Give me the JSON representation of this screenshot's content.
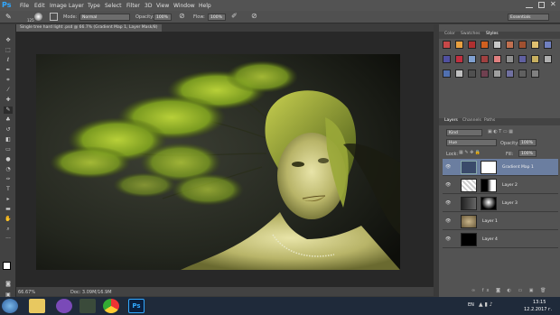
{
  "app": {
    "logo": "Ps"
  },
  "menu": [
    "File",
    "Edit",
    "Image",
    "Layer",
    "Type",
    "Select",
    "Filter",
    "3D",
    "View",
    "Window",
    "Help"
  ],
  "options": {
    "mode_label": "Mode:",
    "mode_value": "Normal",
    "opacity_label": "Opacity:",
    "opacity_value": "100%",
    "flow_label": "Flow:",
    "flow_value": "100%",
    "brush_size": "125",
    "workspace": "Essentials"
  },
  "document": {
    "tab_title": "Single tree  hard light .psd @ 66.7% (Gradient Map 1, Layer Mask/8)",
    "zoom": "66.67%",
    "doc_info": "Doc: 3.09M/16.9M"
  },
  "panels": {
    "color_tabs": [
      "Color",
      "Swatches",
      "Styles"
    ],
    "layer_tabs": [
      "Layers",
      "Channels",
      "Paths"
    ],
    "kind_label": "Kind",
    "blend_mode": "Hue",
    "opacity_label": "Opacity:",
    "opacity_value": "100%",
    "lock_label": "Lock:",
    "fill_label": "Fill:",
    "fill_value": "100%",
    "style_colors": [
      "#c84848",
      "#e8a040",
      "#b03030",
      "#d06020",
      "#c8c8c8",
      "#c07050",
      "#a05030",
      "#e0c070",
      "#7080c0",
      "#5050a0",
      "#c03040",
      "#80a0d0",
      "#a04040",
      "#e08080",
      "#909090",
      "#6060a0",
      "#c8b060",
      "#b0b0b0",
      "#5070b0",
      "#c0c0c0",
      "#505050",
      "#704050",
      "#a0a0a0",
      "#7070a0",
      "#606060",
      "#808080"
    ]
  },
  "layers": [
    {
      "name": "Gradient Map 1",
      "selected": true
    },
    {
      "name": "Layer 2",
      "selected": false
    },
    {
      "name": "Layer 3",
      "selected": false
    },
    {
      "name": "Layer 1",
      "selected": false
    },
    {
      "name": "Layer 4",
      "selected": false
    }
  ],
  "taskbar": {
    "lang": "EN",
    "time": "13:15",
    "date": "12.2.2017 г."
  }
}
